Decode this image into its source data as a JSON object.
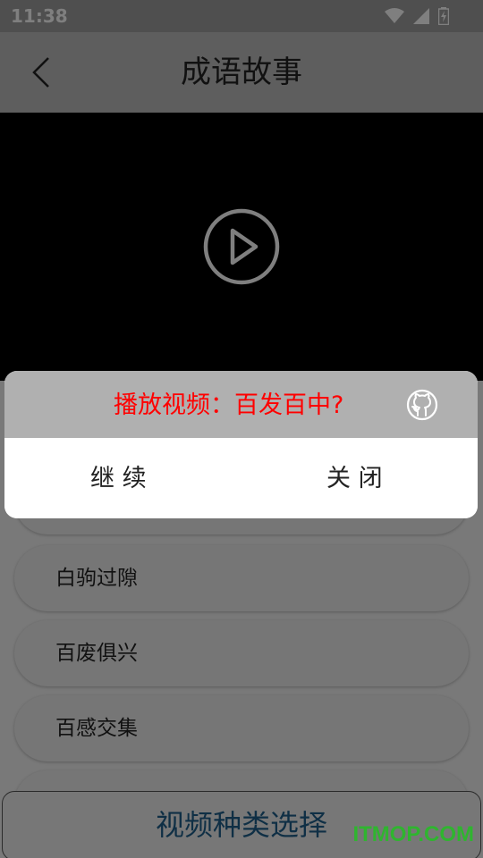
{
  "status_bar": {
    "time": "11:38",
    "icons": [
      "wifi-icon",
      "signal-icon",
      "battery-charging-icon"
    ]
  },
  "app_bar": {
    "title": "成语故事",
    "back_icon": "chevron-left-icon"
  },
  "video": {
    "play_icon": "play-circle-icon"
  },
  "list": {
    "items": [
      {
        "label": "白驹过隙"
      },
      {
        "label": "百废俱兴"
      },
      {
        "label": "百感交集"
      }
    ]
  },
  "bottom_button": {
    "label": "视频种类选择"
  },
  "dialog": {
    "title": "播放视频：百发百中?",
    "icon": "github-icon",
    "continue_label": "继  续",
    "close_label": "关  闭"
  },
  "watermark": {
    "text": "ITMOP.COM"
  },
  "colors": {
    "dialog_title": "#ff0000",
    "bottom_button_text": "#1f5f8b",
    "watermark": "#2fb52f"
  }
}
